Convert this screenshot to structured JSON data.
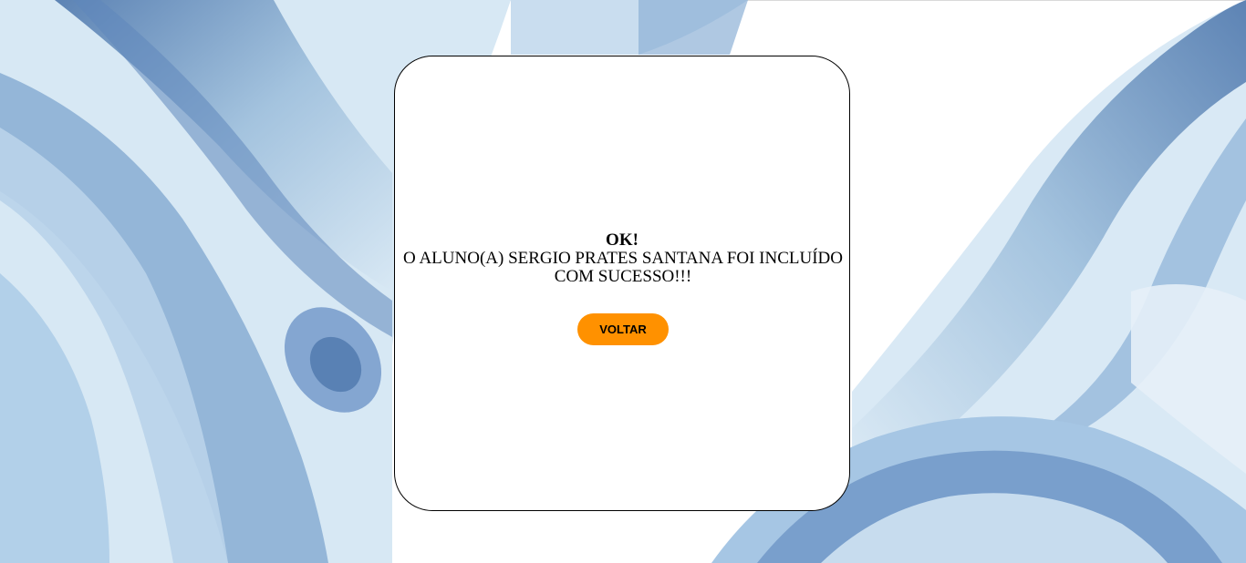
{
  "dialog": {
    "title": "OK!",
    "message": "O ALUNO(A) SERGIO PRATES SANTANA FOI INCLUÍDO COM SUCESSO!!!",
    "button_label": "VOLTAR"
  },
  "colors": {
    "button": "#ff9100",
    "watercolor_dark": "#5f86b9",
    "watercolor_mid": "#93b6d9",
    "watercolor_light": "#cfe2f1"
  }
}
